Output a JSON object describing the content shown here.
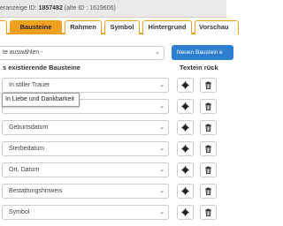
{
  "header": {
    "ad_id_label": "eranzeige ID:",
    "ad_id": "1857482",
    "old_id": "(alte ID : 1619606)"
  },
  "tabs": [
    {
      "label": ""
    },
    {
      "label": "Bausteine"
    },
    {
      "label": "Rahmen"
    },
    {
      "label": "Symbol"
    },
    {
      "label": "Hintergrund"
    },
    {
      "label": "Vorschau"
    }
  ],
  "toolbar": {
    "select_value": "te auswählen -",
    "new_button_label": "Neuen Baustein e"
  },
  "section": {
    "title": "s existierende Bausteine",
    "right_header": "Textein rück"
  },
  "rows": [
    {
      "value": "In stiller Trauer"
    },
    {
      "value": ""
    },
    {
      "value": "Geburtsdatum"
    },
    {
      "value": "Sterbedatum"
    },
    {
      "value": "Ort, Datum"
    },
    {
      "value": "Bestattungshinweis"
    },
    {
      "value": "Symbol"
    }
  ],
  "tooltip": {
    "text": "In Liebe und Dankbarkeit"
  },
  "icons": {
    "chevron": "chevron-down-icon",
    "settings": "gear-icon",
    "delete": "trash-icon"
  },
  "colors": {
    "accent": "#f0a020",
    "primary_button": "#2f7fd1"
  }
}
